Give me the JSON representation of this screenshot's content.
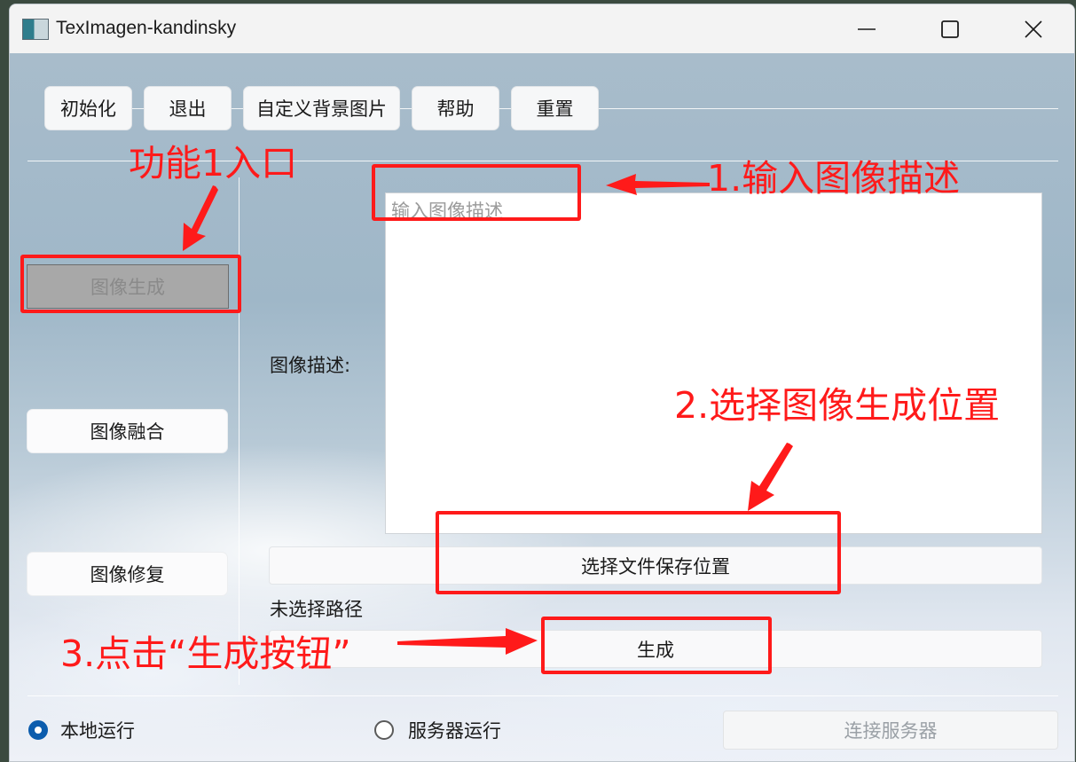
{
  "window": {
    "title": "TexImagen-kandinsky",
    "controls": [
      "minimize",
      "maximize",
      "close"
    ]
  },
  "toolbar": {
    "init_label": "初始化",
    "exit_label": "退出",
    "custom_bg_label": "自定义背景图片",
    "help_label": "帮助",
    "reset_label": "重置"
  },
  "sidebar": {
    "items": [
      {
        "label": "图像生成",
        "active": true
      },
      {
        "label": "图像融合",
        "active": false
      },
      {
        "label": "图像修复",
        "active": false
      }
    ]
  },
  "main": {
    "description_label": "图像描述:",
    "description_placeholder": "输入图像描述",
    "description_value": "",
    "choose_path_button": "选择文件保存位置",
    "path_status": "未选择路径",
    "generate_button": "生成"
  },
  "footer": {
    "local_run_label": "本地运行",
    "local_run_checked": true,
    "server_run_label": "服务器运行",
    "server_run_checked": false,
    "connect_button": "连接服务器",
    "connect_enabled": false
  },
  "annotations": {
    "entry_label": "功能1入口",
    "step1": "1.输入图像描述",
    "step2": "2.选择图像生成位置",
    "step3": "3.点击“生成按钮”",
    "color": "#ff1a1a"
  }
}
